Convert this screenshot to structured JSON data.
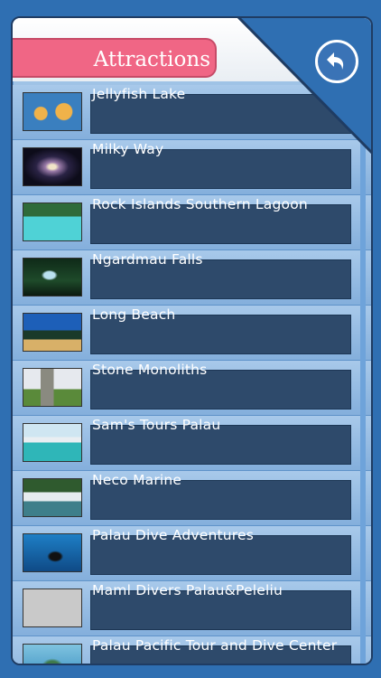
{
  "header": {
    "title": "Attractions",
    "back_icon": "back-arrow-icon"
  },
  "items": [
    {
      "label": "Jellyfish Lake",
      "thumb": "jellyfish-photo"
    },
    {
      "label": "Milky Way",
      "thumb": "galaxy-photo"
    },
    {
      "label": "Rock Islands Southern Lagoon",
      "thumb": "lagoon-photo"
    },
    {
      "label": "Ngardmau Falls",
      "thumb": "waterfall-photo"
    },
    {
      "label": "Long Beach",
      "thumb": "beach-photo"
    },
    {
      "label": "Stone Monoliths",
      "thumb": "monoliths-photo"
    },
    {
      "label": "Sam's Tours Palau",
      "thumb": "boat-tour-photo"
    },
    {
      "label": "Neco Marine",
      "thumb": "marina-photo"
    },
    {
      "label": "Palau Dive Adventures",
      "thumb": "diver-photo"
    },
    {
      "label": "Maml Divers Palau&Peleliu",
      "thumb": "placeholder-photo"
    },
    {
      "label": "Palau Pacific Tour and Dive Center",
      "thumb": "island-aerial-photo"
    }
  ],
  "colors": {
    "title_pill": "#f06685",
    "label_box": "#2e4a6b",
    "frame": "#1f3c63"
  }
}
